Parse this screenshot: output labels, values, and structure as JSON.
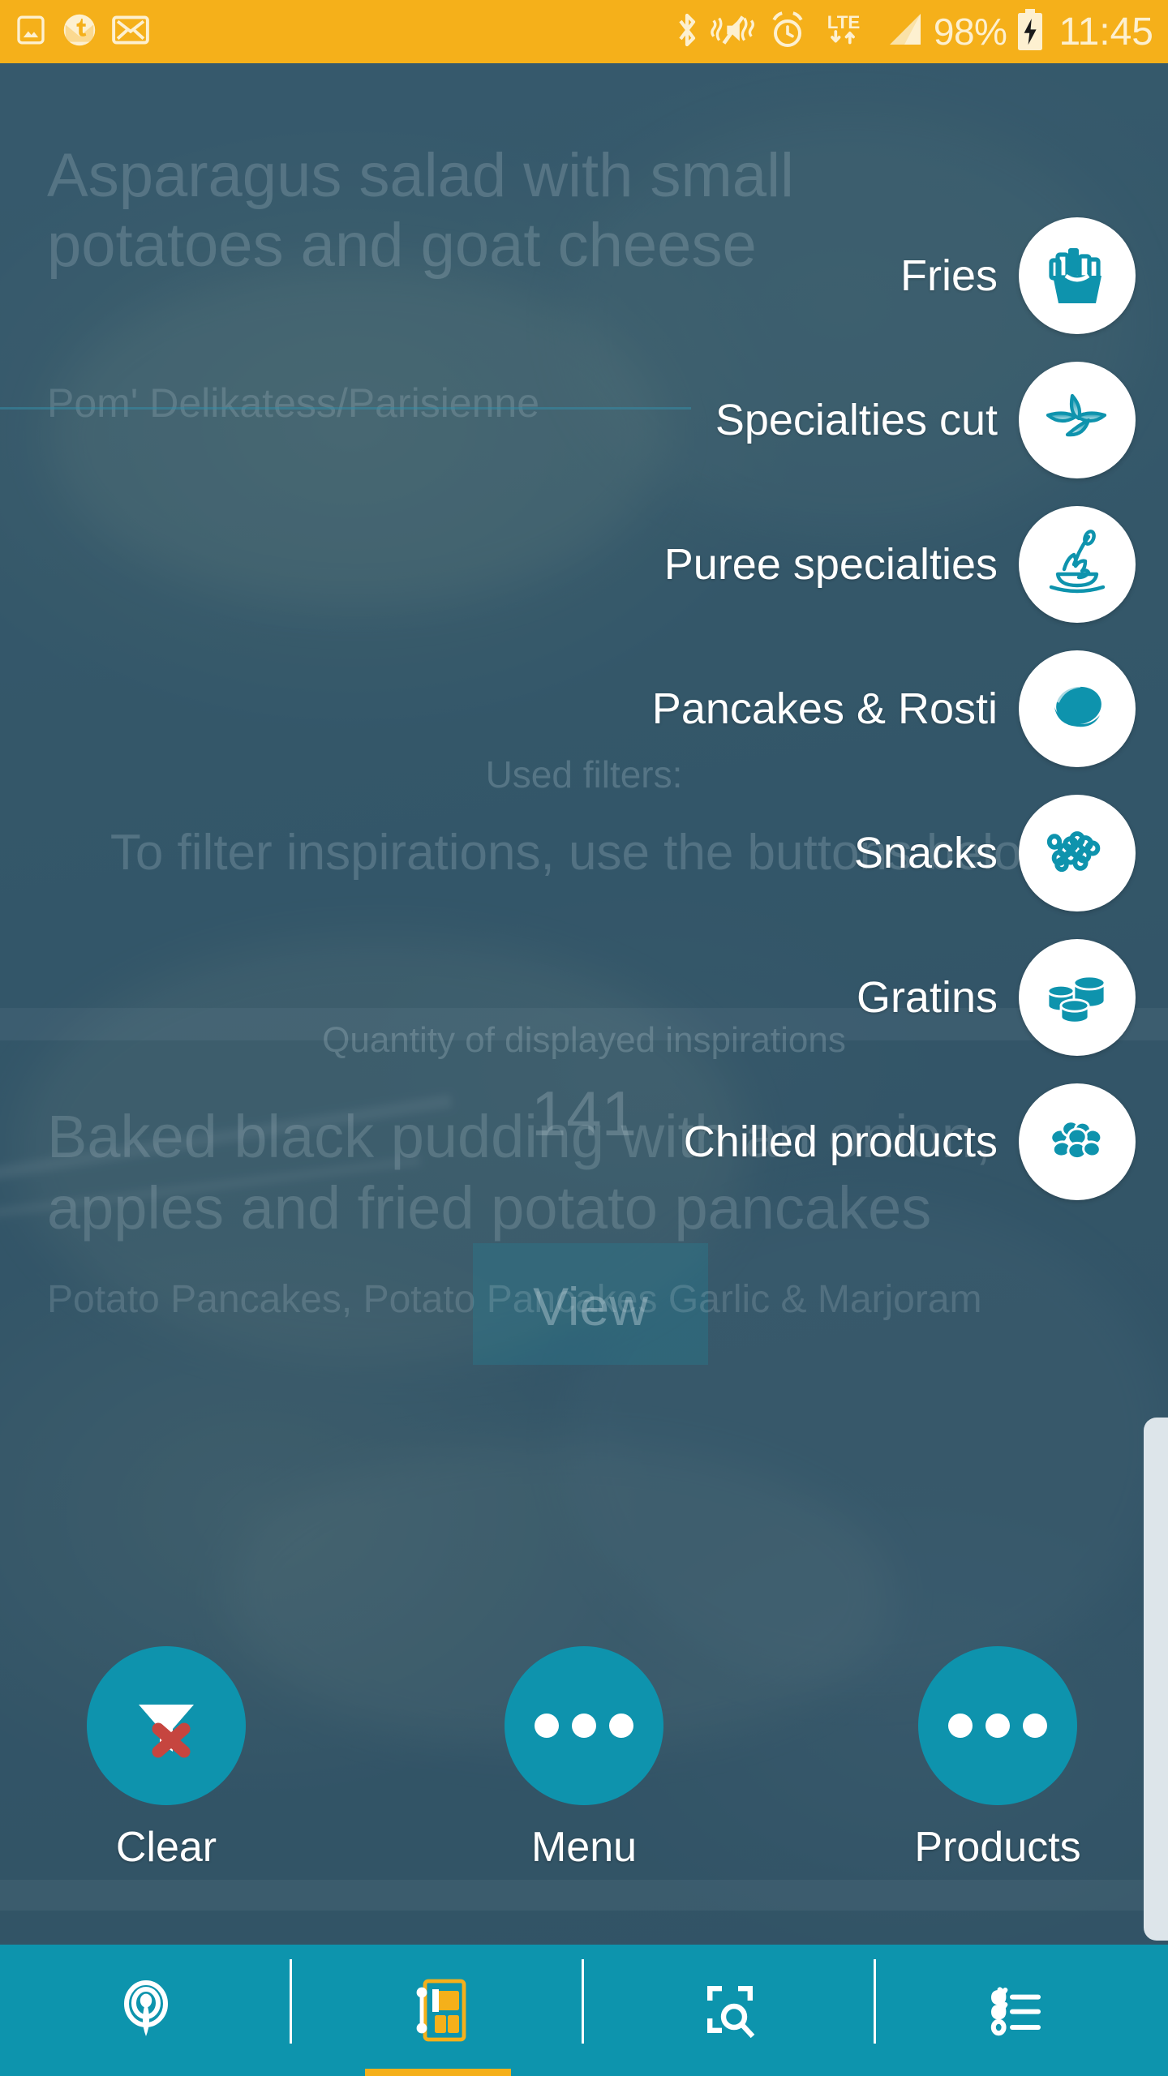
{
  "status_bar": {
    "left_icons": [
      "image-icon",
      "tumblr-envelope-icon",
      "mail-icon"
    ],
    "right_icons": [
      "bluetooth-icon",
      "vibrate-mute-icon",
      "alarm-icon"
    ],
    "network_label": "LTE",
    "signal_icon": "signal-bars-icon",
    "battery_percent": "98%",
    "battery_icon": "battery-charging-icon",
    "time": "11:45"
  },
  "background_page": {
    "recipe_title": "Asparagus salad with small potatoes and goat cheese",
    "recipe_subtitle": "Pom' Delikatess/Parisienne",
    "used_filters_label": "Used filters:",
    "filter_hint": "To filter inspirations, use the buttons below",
    "quantity_label": "Quantity of displayed inspirations",
    "quantity_value": "141",
    "view_button_label": "View",
    "recipe_title_2": "Baked black pudding with an onion, apples and fried potato pancakes",
    "recipe_subtitle_2": "Potato Pancakes, Potato Pancakes Garlic & Marjoram"
  },
  "filter_menu": {
    "items": [
      {
        "label": "Fries",
        "icon": "fries-icon"
      },
      {
        "label": "Specialties cut",
        "icon": "potato-wedges-icon"
      },
      {
        "label": "Puree specialties",
        "icon": "puree-bowl-spoon-icon"
      },
      {
        "label": "Pancakes & Rosti",
        "icon": "pancake-rosti-icon"
      },
      {
        "label": "Snacks",
        "icon": "onion-rings-icon"
      },
      {
        "label": "Gratins",
        "icon": "gratin-cylinders-icon"
      },
      {
        "label": "Chilled products",
        "icon": "potato-cluster-icon"
      }
    ]
  },
  "actions": [
    {
      "label": "Clear",
      "icon": "filter-clear-icon"
    },
    {
      "label": "Menu",
      "icon": "ellipsis-icon"
    },
    {
      "label": "Products",
      "icon": "ellipsis-icon"
    }
  ],
  "bottom_nav": {
    "items": [
      {
        "icon": "beacon-icon",
        "active": false
      },
      {
        "icon": "inspirations-grid-icon",
        "active": true
      },
      {
        "icon": "qr-scan-icon",
        "active": false
      },
      {
        "icon": "checklist-icon",
        "active": false
      }
    ]
  },
  "colors": {
    "status_bar": "#f5b01a",
    "status_bar_text": "#fdf0d0",
    "accent_teal": "#0e93ad",
    "icon_teal": "#0e93ad",
    "nav_bar": "#0d94ad",
    "nav_active_underline": "#f5b01a",
    "overlay_backdrop": "#2e5062",
    "clear_x_red": "#c6453f",
    "scrollbar": "#dde5ea"
  }
}
